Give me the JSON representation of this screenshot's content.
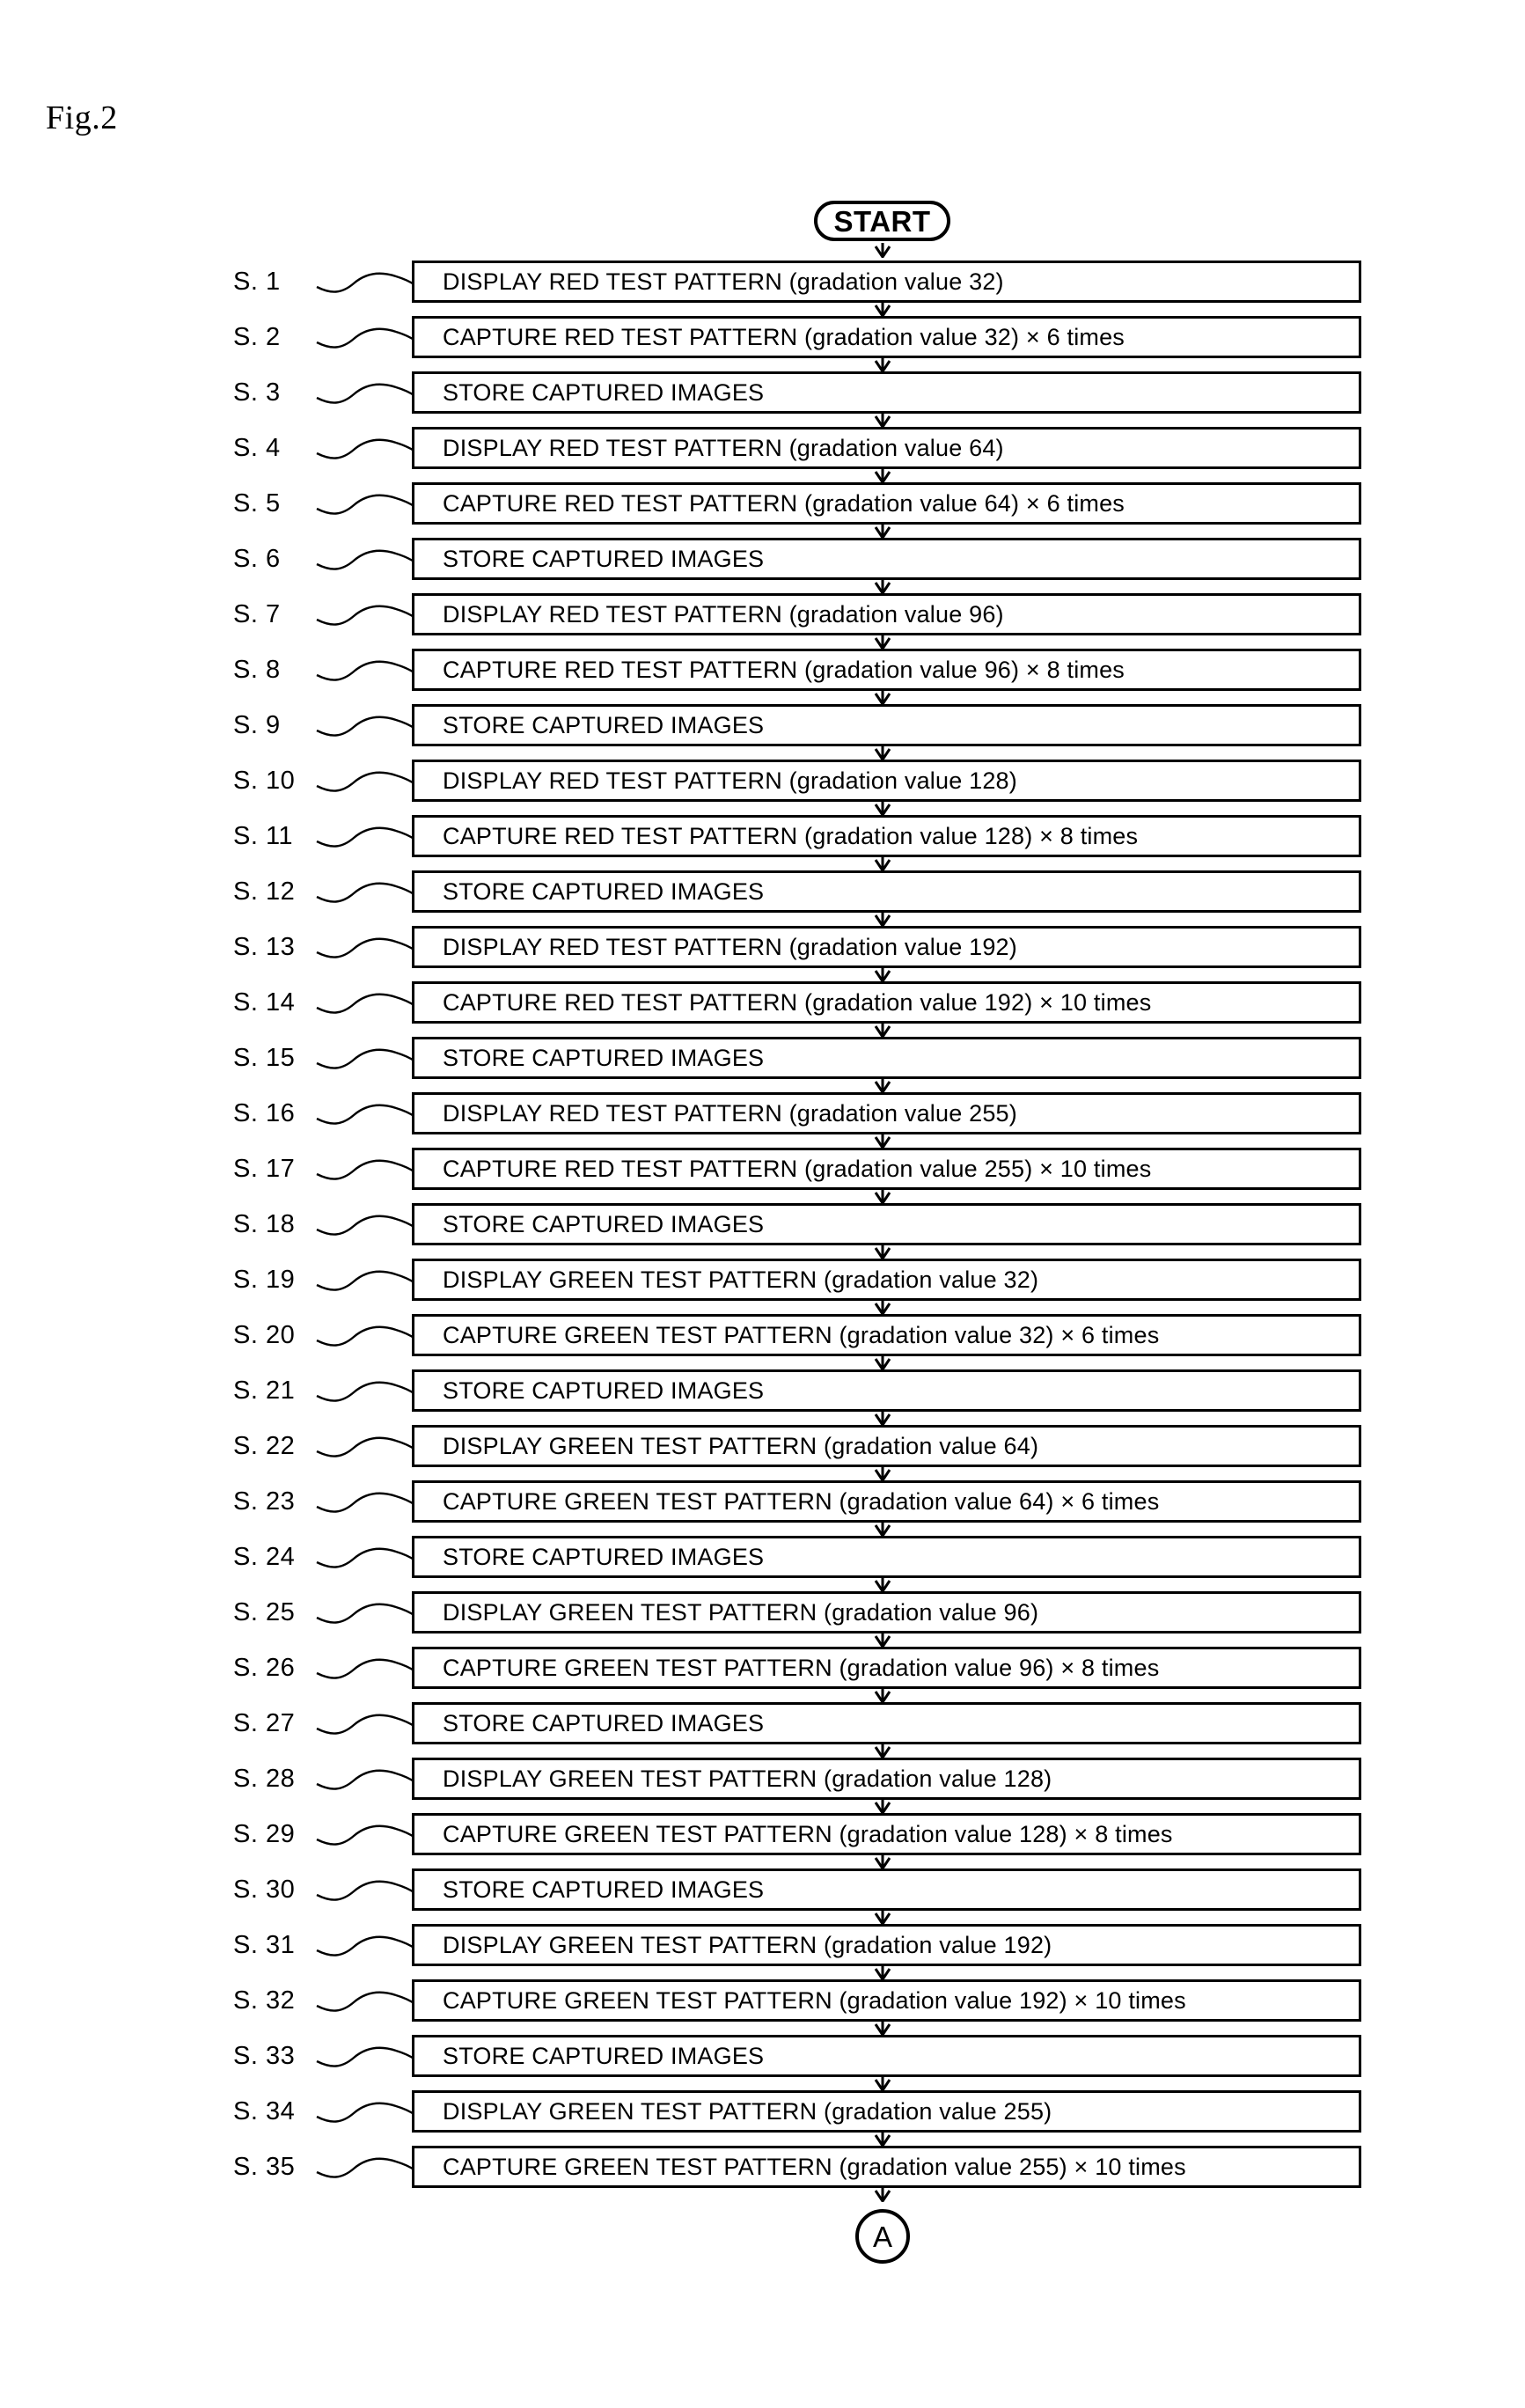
{
  "figure": {
    "caption": "Fig.2"
  },
  "start_node": {
    "label": "START",
    "shape": "rounded-terminator"
  },
  "end_connector": {
    "label": "A",
    "shape": "circle-connector"
  },
  "steps": [
    {
      "id": "S. 1",
      "text": "DISPLAY RED TEST PATTERN (gradation value 32)"
    },
    {
      "id": "S. 2",
      "text": "CAPTURE RED TEST PATTERN (gradation value 32)  × 6 times"
    },
    {
      "id": "S. 3",
      "text": "STORE CAPTURED IMAGES"
    },
    {
      "id": "S. 4",
      "text": "DISPLAY RED TEST PATTERN (gradation value 64)"
    },
    {
      "id": "S. 5",
      "text": "CAPTURE RED TEST PATTERN (gradation value 64)  × 6 times"
    },
    {
      "id": "S. 6",
      "text": "STORE CAPTURED IMAGES"
    },
    {
      "id": "S. 7",
      "text": "DISPLAY RED TEST PATTERN (gradation value 96)"
    },
    {
      "id": "S. 8",
      "text": "CAPTURE RED TEST PATTERN (gradation value 96)  × 8 times"
    },
    {
      "id": "S. 9",
      "text": "STORE CAPTURED IMAGES"
    },
    {
      "id": "S. 10",
      "text": "DISPLAY RED TEST PATTERN (gradation value 128)"
    },
    {
      "id": "S. 11",
      "text": "CAPTURE RED TEST PATTERN (gradation value 128)  × 8 times"
    },
    {
      "id": "S. 12",
      "text": "STORE CAPTURED IMAGES"
    },
    {
      "id": "S. 13",
      "text": "DISPLAY RED TEST PATTERN (gradation value 192)"
    },
    {
      "id": "S. 14",
      "text": "CAPTURE RED TEST PATTERN (gradation value 192)  × 10 times"
    },
    {
      "id": "S. 15",
      "text": "STORE CAPTURED IMAGES"
    },
    {
      "id": "S. 16",
      "text": "DISPLAY RED TEST PATTERN (gradation value 255)"
    },
    {
      "id": "S. 17",
      "text": "CAPTURE RED TEST PATTERN (gradation value 255)  × 10 times"
    },
    {
      "id": "S. 18",
      "text": "STORE CAPTURED IMAGES"
    },
    {
      "id": "S. 19",
      "text": "DISPLAY GREEN TEST PATTERN (gradation value 32)"
    },
    {
      "id": "S. 20",
      "text": "CAPTURE GREEN TEST PATTERN (gradation value 32)  × 6 times"
    },
    {
      "id": "S. 21",
      "text": "STORE CAPTURED IMAGES"
    },
    {
      "id": "S. 22",
      "text": "DISPLAY GREEN TEST PATTERN (gradation value 64)"
    },
    {
      "id": "S. 23",
      "text": "CAPTURE GREEN TEST PATTERN (gradation value 64)  × 6 times"
    },
    {
      "id": "S. 24",
      "text": "STORE CAPTURED IMAGES"
    },
    {
      "id": "S. 25",
      "text": "DISPLAY GREEN TEST PATTERN (gradation value 96)"
    },
    {
      "id": "S. 26",
      "text": "CAPTURE GREEN TEST PATTERN (gradation value 96)  × 8 times"
    },
    {
      "id": "S. 27",
      "text": "STORE CAPTURED IMAGES"
    },
    {
      "id": "S. 28",
      "text": "DISPLAY GREEN TEST PATTERN (gradation value 128)"
    },
    {
      "id": "S. 29",
      "text": "CAPTURE GREEN TEST PATTERN (gradation value 128)  × 8 times"
    },
    {
      "id": "S. 30",
      "text": "STORE CAPTURED IMAGES"
    },
    {
      "id": "S. 31",
      "text": "DISPLAY GREEN TEST PATTERN (gradation value 192)"
    },
    {
      "id": "S. 32",
      "text": "CAPTURE GREEN TEST PATTERN (gradation value 192)  × 10 times"
    },
    {
      "id": "S. 33",
      "text": "STORE CAPTURED IMAGES"
    },
    {
      "id": "S. 34",
      "text": "DISPLAY GREEN TEST PATTERN (gradation value 255)"
    },
    {
      "id": "S. 35",
      "text": "CAPTURE GREEN TEST PATTERN (gradation value 255)  × 10 times"
    }
  ]
}
